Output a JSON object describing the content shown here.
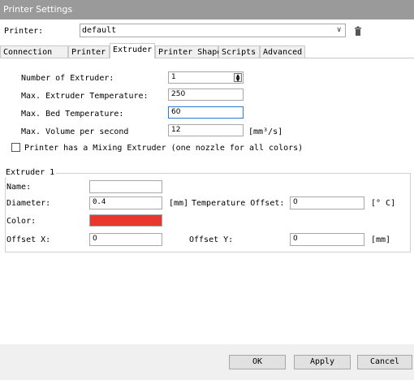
{
  "window": {
    "title": "Printer Settings"
  },
  "printer": {
    "label": "Printer:",
    "selected": "default"
  },
  "tabs": [
    {
      "label": "Connection"
    },
    {
      "label": "Printer"
    },
    {
      "label": "Extruder"
    },
    {
      "label": "Printer Shape"
    },
    {
      "label": "Scripts"
    },
    {
      "label": "Advanced"
    }
  ],
  "extruder_tab": {
    "num_extruder_label": "Number of Extruder:",
    "num_extruder_value": "1",
    "max_extruder_temp_label": "Max. Extruder Temperature:",
    "max_extruder_temp_value": "250",
    "max_bed_temp_label": "Max. Bed Temperature:",
    "max_bed_temp_value": "60",
    "max_volume_label": "Max. Volume per second",
    "max_volume_value": "12",
    "max_volume_unit": "[mm³/s]",
    "mixing_label": "Printer has a Mixing Extruder (one nozzle for all colors)",
    "mixing_checked": false
  },
  "extruder1": {
    "group_title": "Extruder 1",
    "name_label": "Name:",
    "name_value": "",
    "diameter_label": "Diameter:",
    "diameter_value": "0.4",
    "diameter_unit": "[mm]",
    "temp_offset_label": "Temperature Offset:",
    "temp_offset_value": "0",
    "temp_offset_unit": "[° C]",
    "color_label": "Color:",
    "color_value": "#e8372e",
    "offset_x_label": "Offset X:",
    "offset_x_value": "0",
    "offset_y_label": "Offset Y:",
    "offset_y_value": "0",
    "offset_unit": "[mm]"
  },
  "buttons": {
    "ok": "OK",
    "apply": "Apply",
    "cancel": "Cancel"
  }
}
